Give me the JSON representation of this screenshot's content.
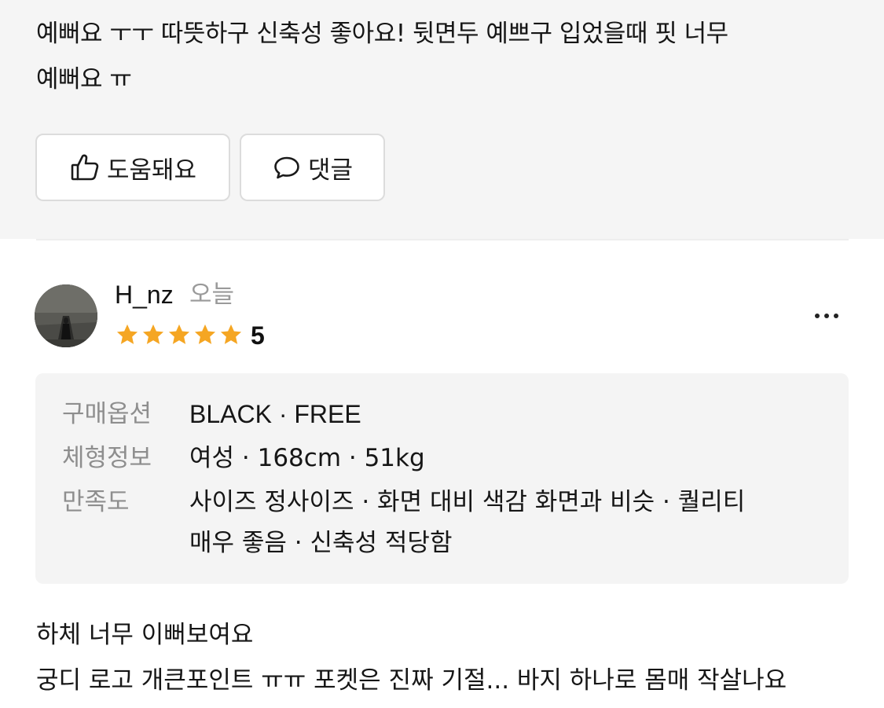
{
  "previous_review": {
    "text_line1": "예뻐요 ㅜㅜ 따뜻하구 신축성 좋아요! 뒷면두 예쁘구 입었을때 핏 너무",
    "text_line2": "예뻐요 ㅠ",
    "helpful_label": "도움돼요",
    "comment_label": "댓글"
  },
  "review": {
    "username": "H_nz",
    "date": "오늘",
    "rating": "5",
    "stars_filled": 5,
    "stars_total": 5,
    "star_color": "#f5a623",
    "purchase_option_label": "구매옵션",
    "purchase_option_value": "BLACK · FREE",
    "body_info_label": "체형정보",
    "body_info_value": "여성 · 168cm · 51kg",
    "satisfaction_label": "만족도",
    "satisfaction_line1": "사이즈 정사이즈 · 화면 대비 색감 화면과 비슷 · 퀄리티",
    "satisfaction_line2": "매우 좋음 · 신축성 적당함",
    "text_line1": "하체 너무 이뻐보여요",
    "text_line2": "궁디 로고 개큰포인트 ㅠㅠ 포켓은 진짜 기절... 바지 하나로 몸매 작살나요"
  }
}
